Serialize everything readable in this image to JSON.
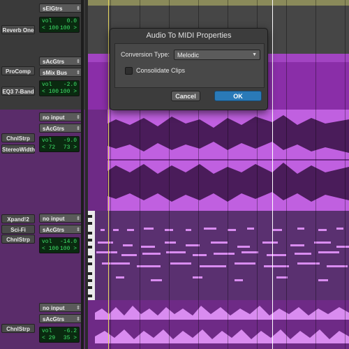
{
  "tracks": [
    {
      "plugins": [
        "Reverb One"
      ],
      "io": [
        "sElGtrs"
      ],
      "vol_label": "vol",
      "vol": "0.0",
      "pan_l": "< 100",
      "pan_r": "100 >"
    },
    {
      "plugins": [
        "ProComp",
        "EQ3 7-Band"
      ],
      "io": [
        "sAcGtrs",
        "sMix Bus"
      ],
      "vol_label": "vol",
      "vol": "-2.0",
      "pan_l": "< 100",
      "pan_r": "100 >"
    },
    {
      "plugins": [
        "ChnlStrp",
        "StereoWidth"
      ],
      "io": [
        "no input",
        "sAcGtrs"
      ],
      "vol_label": "vol",
      "vol": "-9.0",
      "pan_l": "< 72",
      "pan_r": "73 >"
    },
    {
      "plugins": [
        "Xpand!2",
        "Sci-Fi",
        "ChnlStrp"
      ],
      "io": [
        "no input",
        "sAcGtrs"
      ],
      "vol_label": "vol",
      "vol": "-14.0",
      "pan_l": "< 100",
      "pan_r": "100 >"
    },
    {
      "plugins": [
        "ChnlStrp"
      ],
      "io": [
        "no input",
        "sAcGtrs"
      ],
      "vol_label": "vol",
      "vol": "-6.2",
      "pan_l": "< 29",
      "pan_r": "35 >"
    }
  ],
  "dialog": {
    "title": "Audio To MIDI Properties",
    "conversion_label": "Conversion Type:",
    "conversion_value": "Melodic",
    "consolidate_label": "Consolidate Clips",
    "consolidate_checked": false,
    "cancel_label": "Cancel",
    "ok_label": "OK"
  },
  "colors": {
    "clip_purple": "#9b35b8",
    "clip_light": "#e07ef4",
    "midi_note": "#d98cf0",
    "ok_blue": "#2a7ab8",
    "lcd_green": "#3fe36a"
  }
}
